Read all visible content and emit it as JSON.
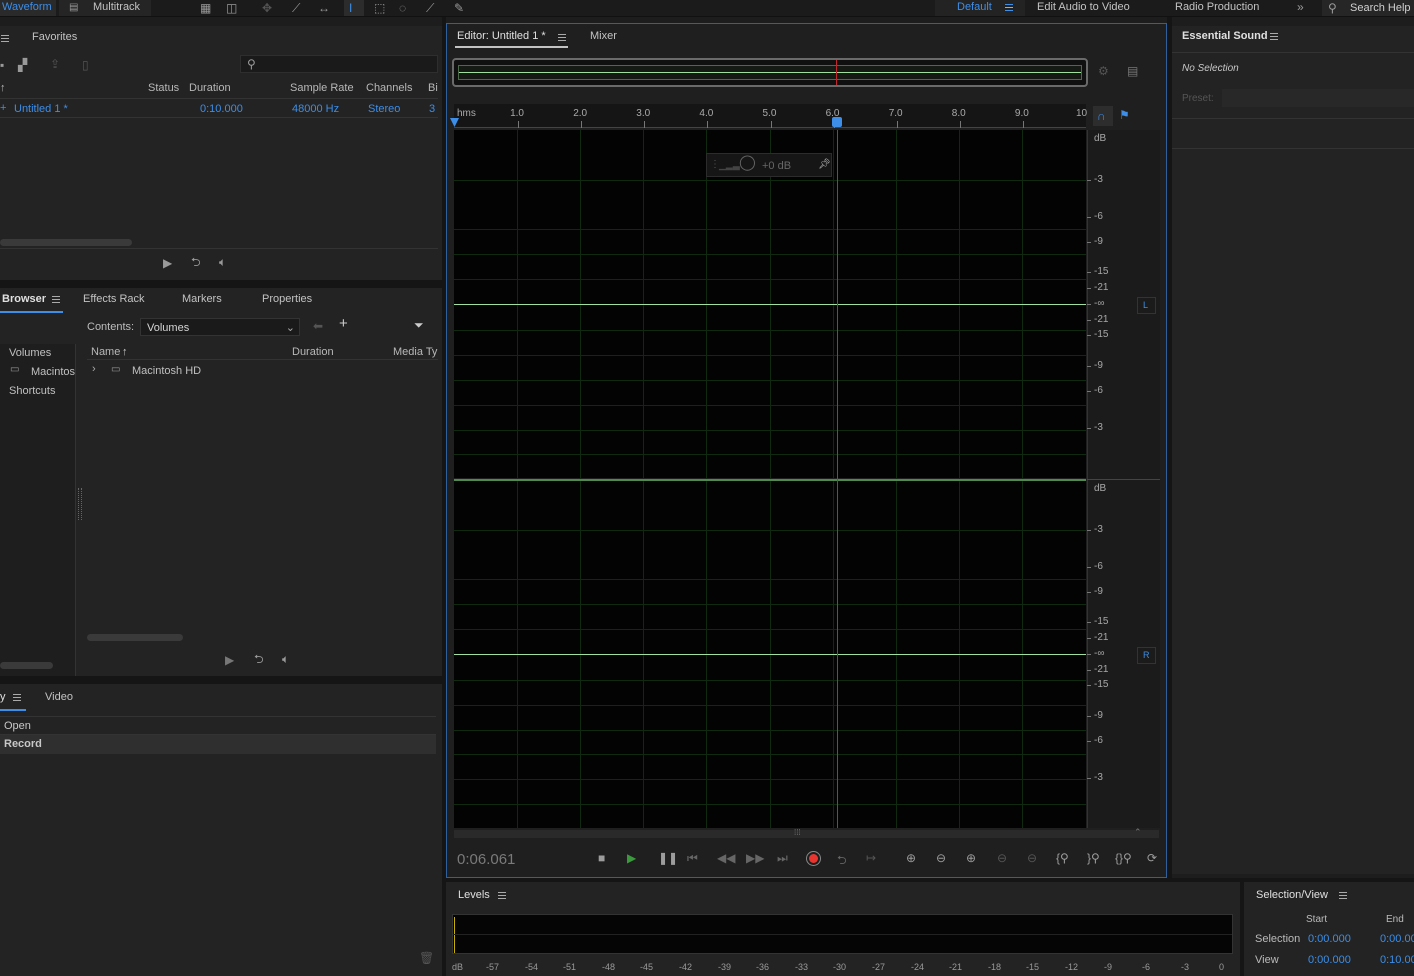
{
  "topbar": {
    "waveform": "Waveform",
    "multitrack": "Multitrack",
    "workspaces": [
      "Default",
      "Edit Audio to Video",
      "Radio Production"
    ],
    "search": "Search Help"
  },
  "files": {
    "tab": "Favorites",
    "columns": [
      "Status",
      "Duration",
      "Sample Rate",
      "Channels",
      "Bi"
    ],
    "row": {
      "name": "Untitled 1 *",
      "duration": "0:10.000",
      "sample_rate": "48000 Hz",
      "channels": "Stereo",
      "bits": "3"
    }
  },
  "browser": {
    "tabs": [
      "Browser",
      "Effects Rack",
      "Markers",
      "Properties"
    ],
    "contents_label": "Contents:",
    "contents_value": "Volumes",
    "tree": [
      "Volumes",
      "Macintos",
      "Shortcuts"
    ],
    "columns": [
      "Name",
      "Duration",
      "Media Ty"
    ],
    "item": "Macintosh HD"
  },
  "history": {
    "tabs": [
      "y",
      "Video"
    ],
    "items": [
      "Open",
      "Record"
    ]
  },
  "editor": {
    "tab": "Editor: Untitled 1 *",
    "mixer": "Mixer",
    "ruler": [
      "hms",
      "1.0",
      "2.0",
      "3.0",
      "4.0",
      "5.0",
      "6.0",
      "7.0",
      "8.0",
      "9.0",
      "10"
    ],
    "hud_gain": "+0 dB",
    "db_label": "dB",
    "db_ticks_top": [
      "-3",
      "-6",
      "-9",
      "-15",
      "-21",
      "-∞",
      "-21",
      "-15",
      "-9",
      "-6",
      "-3"
    ],
    "channel_l": "L",
    "channel_r": "R",
    "time": "0:06.061",
    "playhead_seconds": 6.061
  },
  "essential_sound": {
    "title": "Essential Sound",
    "no_selection": "No Selection",
    "preset": "Preset:"
  },
  "levels": {
    "title": "Levels",
    "scale": [
      "dB",
      "-57",
      "-54",
      "-51",
      "-48",
      "-45",
      "-42",
      "-39",
      "-36",
      "-33",
      "-30",
      "-27",
      "-24",
      "-21",
      "-18",
      "-15",
      "-12",
      "-9",
      "-6",
      "-3",
      "0"
    ]
  },
  "selection_view": {
    "title": "Selection/View",
    "start": "Start",
    "end": "End",
    "selection_label": "Selection",
    "view_label": "View",
    "selection_start": "0:00.000",
    "selection_end": "0:00.00",
    "view_start": "0:00.000",
    "view_end": "0:10.00"
  },
  "colors": {
    "accent": "#3d8ee8",
    "playhead": "#c0262b",
    "wave": "#9fe09f",
    "record": "#e8352f"
  }
}
